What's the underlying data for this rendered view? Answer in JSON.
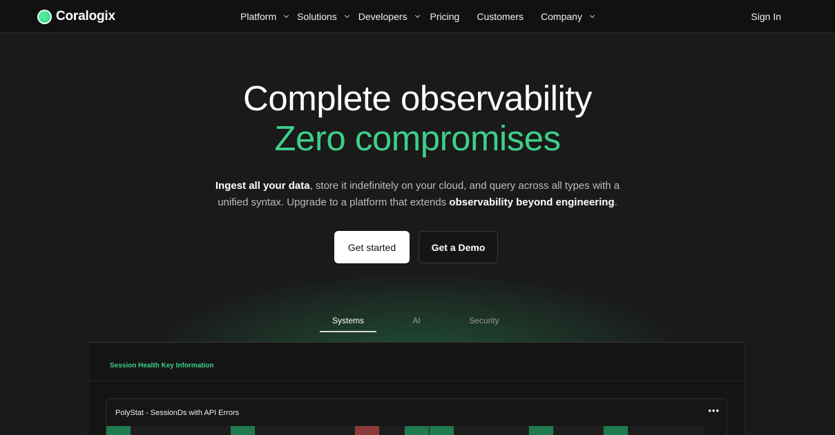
{
  "nav": {
    "logo_text": "Coralogix",
    "items": [
      {
        "label": "Platform",
        "has_dropdown": true
      },
      {
        "label": "Solutions",
        "has_dropdown": true
      },
      {
        "label": "Developers",
        "has_dropdown": true
      },
      {
        "label": "Pricing",
        "has_dropdown": false
      },
      {
        "label": "Customers",
        "has_dropdown": false
      },
      {
        "label": "Company",
        "has_dropdown": true
      }
    ],
    "sign_in": "Sign In"
  },
  "hero": {
    "headline": "Complete observability",
    "headline_accent": "Zero compromises",
    "sub_bold_1": "Ingest all your data",
    "sub_text_1": ", store it indefinitely on your cloud, and query across all types with a unified syntax. Upgrade to a platform that extends ",
    "sub_bold_2": "observability beyond engineering",
    "sub_text_2": ".",
    "cta_primary": "Get started",
    "cta_secondary": "Get a Demo"
  },
  "tabs": [
    {
      "label": "Systems",
      "active": true
    },
    {
      "label": "AI",
      "active": false
    },
    {
      "label": "Security",
      "active": false
    }
  ],
  "dashboard": {
    "section_title": "Session Health Key Information",
    "card_title": "PolyStat - SessionDs with API Errors",
    "menu_glyph": "•••",
    "cells": [
      "ok",
      "none",
      "none",
      "none",
      "none",
      "ok",
      "none",
      "none",
      "none",
      "none",
      "err",
      "none",
      "ok",
      "ok",
      "none",
      "none",
      "none",
      "ok",
      "none",
      "none",
      "ok",
      "none",
      "none",
      "none"
    ]
  },
  "colors": {
    "accent_green": "#3ecf8a",
    "background": "#1a1a1a",
    "nav_background": "#111111",
    "ok_cell": "#1f7a4d",
    "error_cell": "#8c3a3a"
  }
}
